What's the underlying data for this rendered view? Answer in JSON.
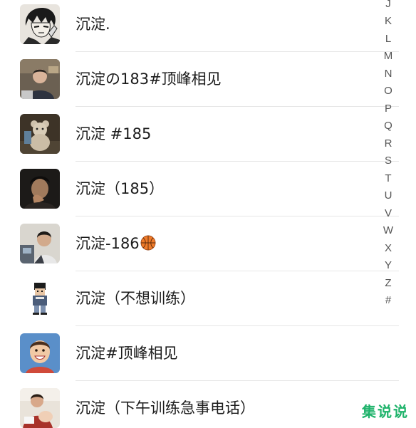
{
  "contacts": [
    {
      "name": "沉淀.",
      "avatar": "manga-man-avatar"
    },
    {
      "name": "沉淀の183#顶峰相见",
      "avatar": "man-at-desk-avatar"
    },
    {
      "name": "沉淀 #185",
      "avatar": "teddy-bear-avatar"
    },
    {
      "name": "沉淀（185）",
      "avatar": "man-dark-avatar"
    },
    {
      "name": "沉淀-186",
      "avatar": "man-room-avatar",
      "emoji": "basketball-icon"
    },
    {
      "name": "沉淀（不想训练）",
      "avatar": "pixel-character-avatar"
    },
    {
      "name": "沉淀#顶峰相见",
      "avatar": "smiling-boy-avatar"
    },
    {
      "name": "沉淀（下午训练急事电话）",
      "avatar": "man-holding-baby-avatar"
    }
  ],
  "alpha_index": [
    "J",
    "K",
    "L",
    "M",
    "N",
    "O",
    "P",
    "Q",
    "R",
    "S",
    "T",
    "U",
    "V",
    "W",
    "X",
    "Y",
    "Z",
    "#"
  ],
  "watermark": "集说说",
  "colors": {
    "text": "#1c1c1c",
    "index_text": "#555555",
    "divider": "#e6e6e6",
    "watermark": "#1fb36b"
  }
}
